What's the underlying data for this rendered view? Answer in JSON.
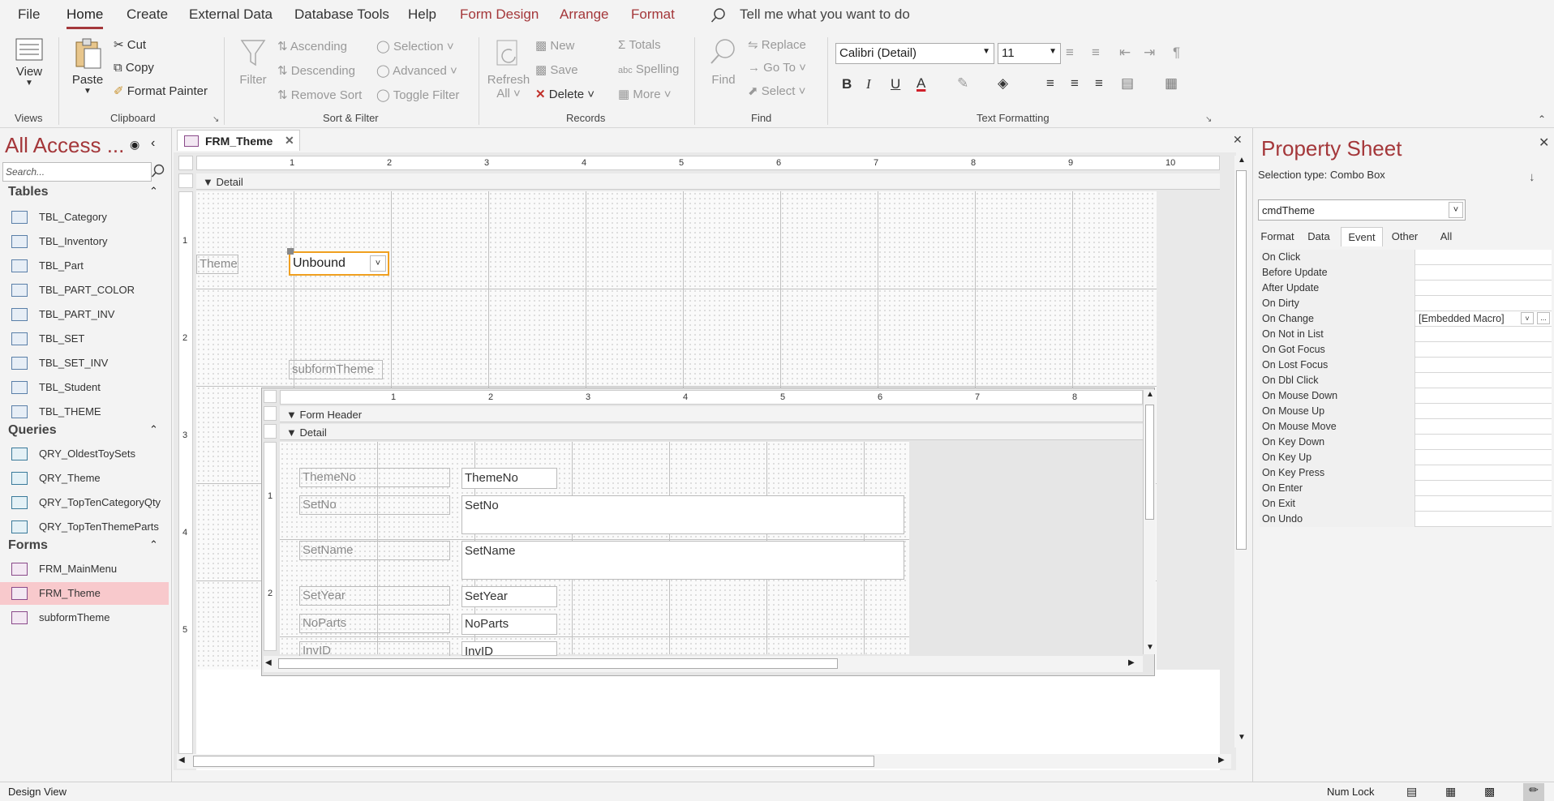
{
  "menu": {
    "tabs": [
      "File",
      "Home",
      "Create",
      "External Data",
      "Database Tools",
      "Help",
      "Form Design",
      "Arrange",
      "Format"
    ],
    "tell_me": "Tell me what you want to do"
  },
  "ribbon": {
    "views": {
      "view": "View",
      "group": "Views"
    },
    "clipboard": {
      "paste": "Paste",
      "cut": "Cut",
      "copy": "Copy",
      "format_painter": "Format Painter",
      "group": "Clipboard"
    },
    "sort_filter": {
      "filter": "Filter",
      "ascending": "Ascending",
      "descending": "Descending",
      "remove_sort": "Remove Sort",
      "selection": "Selection",
      "advanced": "Advanced",
      "toggle_filter": "Toggle Filter",
      "group": "Sort & Filter"
    },
    "records": {
      "refresh": "Refresh",
      "refresh_all": "All",
      "new": "New",
      "save": "Save",
      "delete": "Delete",
      "totals": "Totals",
      "spelling": "Spelling",
      "more": "More",
      "group": "Records"
    },
    "find": {
      "find": "Find",
      "replace": "Replace",
      "goto": "Go To",
      "select": "Select",
      "group": "Find"
    },
    "text_formatting": {
      "font": "Calibri (Detail)",
      "size": "11",
      "bold": "B",
      "italic": "I",
      "underline": "U",
      "group": "Text Formatting"
    }
  },
  "nav": {
    "title": "All Access ...",
    "search_placeholder": "Search...",
    "tables_label": "Tables",
    "tables": [
      "TBL_Category",
      "TBL_Inventory",
      "TBL_Part",
      "TBL_PART_COLOR",
      "TBL_PART_INV",
      "TBL_SET",
      "TBL_SET_INV",
      "TBL_Student",
      "TBL_THEME"
    ],
    "queries_label": "Queries",
    "queries": [
      "QRY_OldestToySets",
      "QRY_Theme",
      "QRY_TopTenCategoryQty",
      "QRY_TopTenThemeParts"
    ],
    "forms_label": "Forms",
    "forms": [
      "FRM_MainMenu",
      "FRM_Theme",
      "subformTheme"
    ]
  },
  "document": {
    "tab": "FRM_Theme",
    "detail": "Detail",
    "theme_label": "Theme",
    "combo_value": "Unbound",
    "subform_label": "subformTheme",
    "subform": {
      "form_header": "Form Header",
      "detail": "Detail",
      "fields": [
        {
          "label": "ThemeNo",
          "value": "ThemeNo"
        },
        {
          "label": "SetNo",
          "value": "SetNo"
        },
        {
          "label": "SetName",
          "value": "SetName"
        },
        {
          "label": "SetYear",
          "value": "SetYear"
        },
        {
          "label": "NoParts",
          "value": "NoParts"
        },
        {
          "label": "InvID",
          "value": "InvID"
        }
      ]
    },
    "ruler_main": [
      "1",
      "2",
      "3",
      "4",
      "5",
      "6",
      "7",
      "8",
      "9",
      "10"
    ],
    "ruler_sub": [
      "1",
      "2",
      "3",
      "4",
      "5",
      "6",
      "7",
      "8"
    ],
    "vruler_main": [
      "1",
      "2",
      "3",
      "4",
      "5"
    ],
    "vruler_sub": [
      "1",
      "2"
    ]
  },
  "property_sheet": {
    "title": "Property Sheet",
    "selection_type": "Selection type:  Combo Box",
    "selected_control": "cmdTheme",
    "tabs": [
      "Format",
      "Data",
      "Event",
      "Other",
      "All"
    ],
    "active_tab": "Event",
    "rows": [
      {
        "name": "On Click",
        "value": ""
      },
      {
        "name": "Before Update",
        "value": ""
      },
      {
        "name": "After Update",
        "value": ""
      },
      {
        "name": "On Dirty",
        "value": ""
      },
      {
        "name": "On Change",
        "value": "[Embedded Macro]"
      },
      {
        "name": "On Not in List",
        "value": ""
      },
      {
        "name": "On Got Focus",
        "value": ""
      },
      {
        "name": "On Lost Focus",
        "value": ""
      },
      {
        "name": "On Dbl Click",
        "value": ""
      },
      {
        "name": "On Mouse Down",
        "value": ""
      },
      {
        "name": "On Mouse Up",
        "value": ""
      },
      {
        "name": "On Mouse Move",
        "value": ""
      },
      {
        "name": "On Key Down",
        "value": ""
      },
      {
        "name": "On Key Up",
        "value": ""
      },
      {
        "name": "On Key Press",
        "value": ""
      },
      {
        "name": "On Enter",
        "value": ""
      },
      {
        "name": "On Exit",
        "value": ""
      },
      {
        "name": "On Undo",
        "value": ""
      }
    ]
  },
  "status": {
    "left": "Design View",
    "num_lock": "Num Lock"
  },
  "colors": {
    "accent": "#a4373a",
    "selection": "#f8c9cc",
    "control_focus": "#f0a020"
  }
}
